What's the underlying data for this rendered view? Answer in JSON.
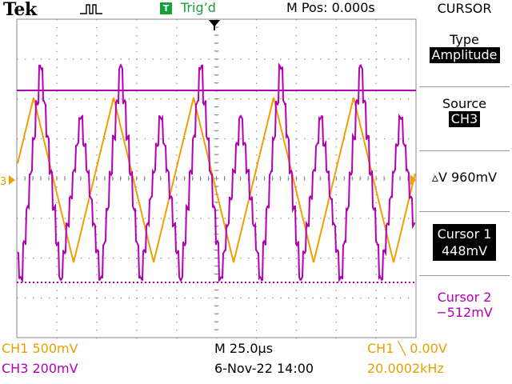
{
  "header": {
    "brand": "Tek",
    "trigger_badge": "T",
    "trigger_status": "Trig’d",
    "position": "M Pos: 0.000s"
  },
  "menu": {
    "title": "CURSOR",
    "type_label": "Type",
    "type_value": "Amplitude",
    "source_label": "Source",
    "source_value": "CH3",
    "delta": "▵V 960mV",
    "cursor1_label": "Cursor 1",
    "cursor1_value": "448mV",
    "cursor2_label": "Cursor 2",
    "cursor2_value": "−512mV"
  },
  "footer": {
    "ch1_scale": "CH1  500mV",
    "ch3_scale": "CH3  200mV",
    "timebase": "M 25.0µs",
    "datetime": "6-Nov-22 14:00",
    "trigger": "CH1 ╲ 0.00V",
    "frequency": "20.0002kHz"
  },
  "markers": {
    "ch_marker": "3"
  },
  "colors": {
    "ch1": "#f0a000",
    "ch3": "#b400b4",
    "trigger_green": "#14a03a",
    "grid": "#8a8a8a"
  },
  "icons": [
    "acquisition-icon",
    "trigger-position-icon",
    "channel-marker-icon",
    "trigger-level-icon"
  ]
}
